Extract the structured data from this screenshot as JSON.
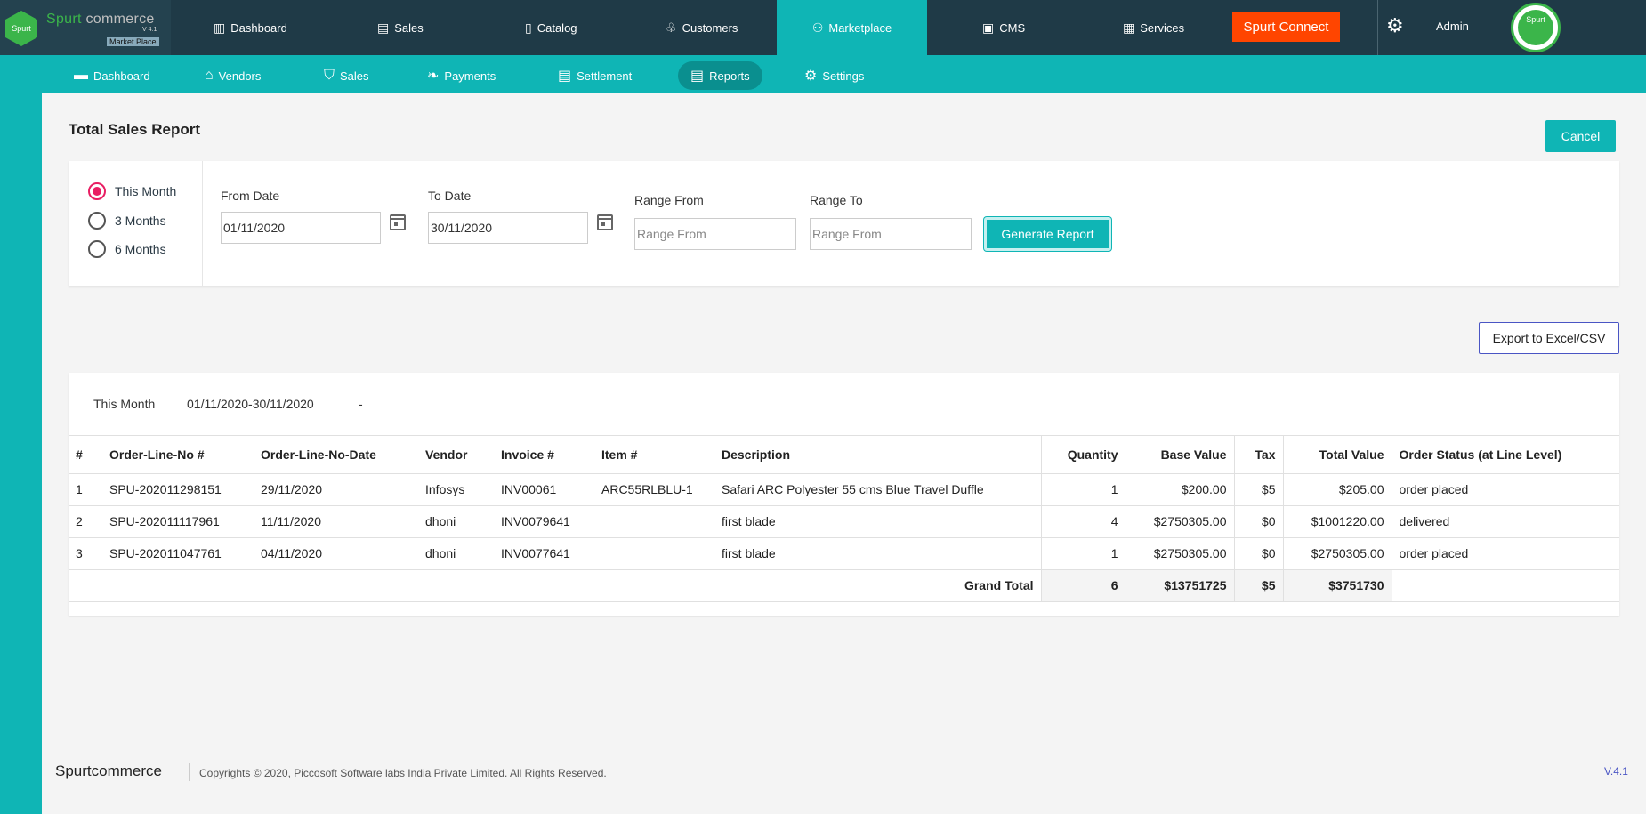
{
  "logo": {
    "name_a": "Spurt",
    "name_b": " commerce",
    "version": "V 4.1",
    "tagline": "Market Place",
    "badge": "Spurt"
  },
  "topnav": [
    {
      "label": "Dashboard",
      "icon": "bar-chart-icon"
    },
    {
      "label": "Sales",
      "icon": "clipboard-icon"
    },
    {
      "label": "Catalog",
      "icon": "catalog-icon"
    },
    {
      "label": "Customers",
      "icon": "customers-icon"
    },
    {
      "label": "Marketplace",
      "icon": "user-icon"
    },
    {
      "label": "CMS",
      "icon": "cms-icon"
    },
    {
      "label": "Services",
      "icon": "services-icon"
    }
  ],
  "connect_label": "Spurt Connect",
  "admin_label": "Admin",
  "avatar_label": "Spurt",
  "subnav": [
    {
      "label": "Dashboard",
      "icon": "dashboard-icon"
    },
    {
      "label": "Vendors",
      "icon": "vendors-icon"
    },
    {
      "label": "Sales",
      "icon": "basket-icon"
    },
    {
      "label": "Payments",
      "icon": "handshake-icon"
    },
    {
      "label": "Settlement",
      "icon": "settlement-icon"
    },
    {
      "label": "Reports",
      "icon": "reports-icon"
    },
    {
      "label": "Settings",
      "icon": "gear-icon"
    }
  ],
  "page_title": "Total Sales Report",
  "cancel_label": "Cancel",
  "filters": {
    "periods": [
      "This Month",
      "3 Months",
      "6 Months"
    ],
    "selected_period": "This Month",
    "from_label": "From Date",
    "from_value": "01/11/2020",
    "to_label": "To Date",
    "to_value": "30/11/2020",
    "range_from_label": "Range From",
    "range_from_placeholder": "Range From",
    "range_to_label": "Range To",
    "range_to_placeholder": "Range From",
    "generate_label": "Generate Report"
  },
  "export_label": "Export to Excel/CSV",
  "report": {
    "period": "This Month",
    "dates": "01/11/2020-30/11/2020",
    "dash": "-",
    "columns": [
      "#",
      "Order-Line-No #",
      "Order-Line-No-Date",
      "Vendor",
      "Invoice #",
      "Item #",
      "Description",
      "Quantity",
      "Base Value",
      "Tax",
      "Total Value",
      "Order Status (at Line Level)"
    ],
    "rows": [
      [
        "1",
        "SPU-202011298151",
        "29/11/2020",
        "Infosys",
        "INV00061",
        "ARC55RLBLU-1",
        "Safari ARC Polyester 55 cms Blue Travel Duffle",
        "1",
        "$200.00",
        "$5",
        "$205.00",
        "order placed"
      ],
      [
        "2",
        "SPU-202011117961",
        "11/11/2020",
        "dhoni",
        "INV0079641",
        "",
        "first blade",
        "4",
        "$2750305.00",
        "$0",
        "$1001220.00",
        "delivered"
      ],
      [
        "3",
        "SPU-202011047761",
        "04/11/2020",
        "dhoni",
        "INV0077641",
        "",
        "first blade",
        "1",
        "$2750305.00",
        "$0",
        "$2750305.00",
        "order placed"
      ]
    ],
    "total": {
      "label": "Grand Total",
      "quantity": "6",
      "base": "$13751725",
      "tax": "$5",
      "total": "$3751730"
    }
  },
  "footer": {
    "brand": "Spurtcommerce",
    "copyright": "Copyrights © 2020, Piccosoft Software labs India Private Limited. All Rights Reserved.",
    "version": "V.4.1"
  }
}
